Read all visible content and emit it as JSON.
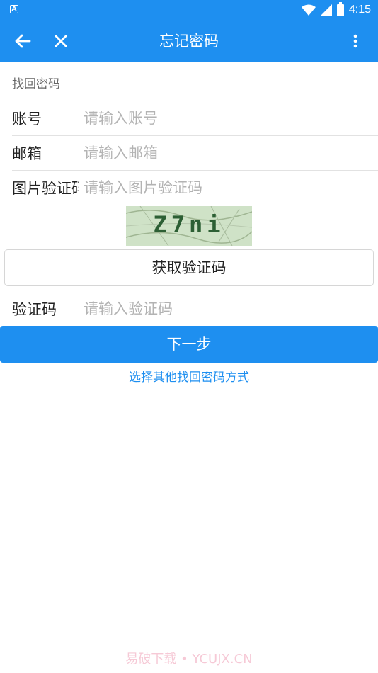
{
  "status_bar": {
    "time": "4:15",
    "notification_icon": "A"
  },
  "app_bar": {
    "title": "忘记密码"
  },
  "form": {
    "section_title": "找回密码",
    "account": {
      "label": "账号",
      "placeholder": "请输入账号"
    },
    "email": {
      "label": "邮箱",
      "placeholder": "请输入邮箱"
    },
    "image_captcha": {
      "label": "图片验证码",
      "placeholder": "请输入图片验证码",
      "captcha_text": "Z7ni"
    },
    "get_code_label": "获取验证码",
    "code": {
      "label": "验证码",
      "placeholder": "请输入验证码"
    }
  },
  "next_button": "下一步",
  "other_methods_link": "选择其他找回密码方式",
  "watermark": "易破下载 • YCUJX.CN",
  "colors": {
    "primary": "#1e8ff0",
    "placeholder": "#b3b3b3",
    "divider": "#e2e2e2"
  }
}
